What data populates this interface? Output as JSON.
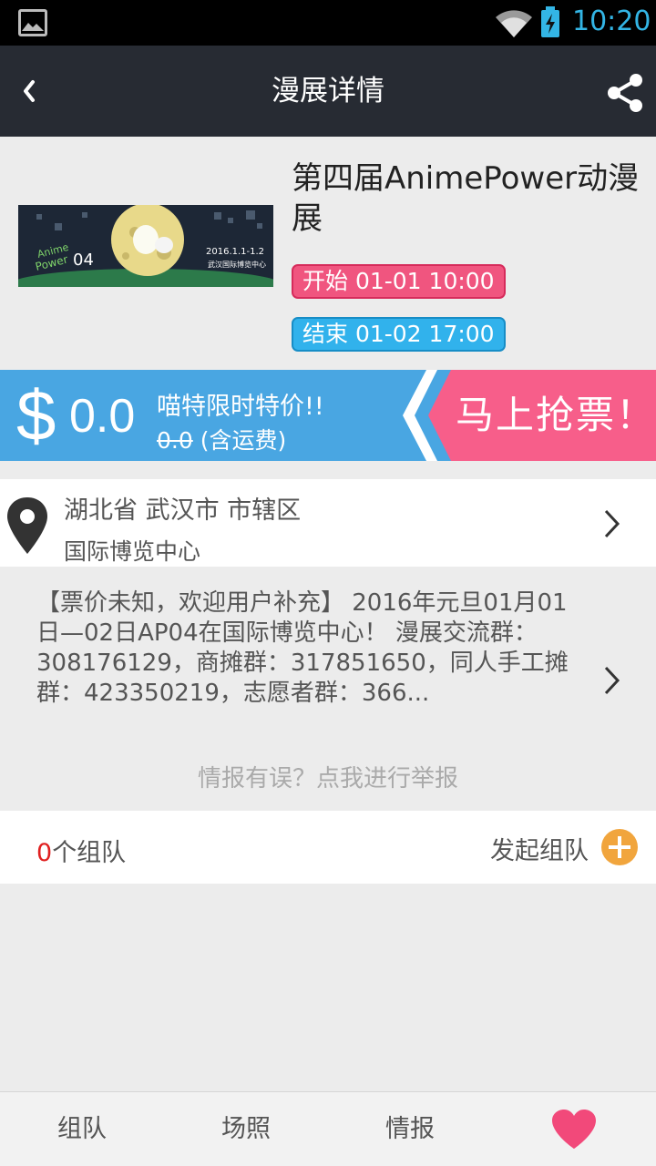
{
  "status_bar": {
    "time": "10:20"
  },
  "nav": {
    "title": "漫展详情"
  },
  "event": {
    "title": "第四届AnimePower动漫展",
    "banner": {
      "logo_line1": "Anime",
      "logo_line2": "Power",
      "logo_num": "04",
      "date": "2016.1.1-1.2",
      "venue": "武汉国际博览中心"
    },
    "start_label": "开始 01-01 10:00",
    "end_label": "结束 01-02 17:00"
  },
  "promo": {
    "currency": "$",
    "price": "0.0",
    "title": "喵特限时特价!!",
    "original_price": "0.0",
    "shipping_note": " (含运费)",
    "buy_label": "马上抢票！"
  },
  "address": {
    "line1": "湖北省 武汉市 市辖区",
    "line2": "国际博览中心"
  },
  "description": {
    "text": "【票价未知，欢迎用户补充】 2016年元旦01月01日—02日AP04在国际博览中心！ 漫展交流群：308176129，商摊群：317851650，同人手工摊群：423350219，志愿者群：366...",
    "report_link": "情报有误？点我进行举报"
  },
  "teams": {
    "count": "0",
    "count_suffix": "个组队",
    "start_label": "发起组队"
  },
  "tabs": [
    {
      "label": "组队"
    },
    {
      "label": "场照"
    },
    {
      "label": "情报"
    }
  ],
  "colors": {
    "pink": "#f0557f",
    "blue": "#31b2ec",
    "orange": "#f1a53d",
    "navbar": "#272b33",
    "heart": "#f2497a"
  }
}
